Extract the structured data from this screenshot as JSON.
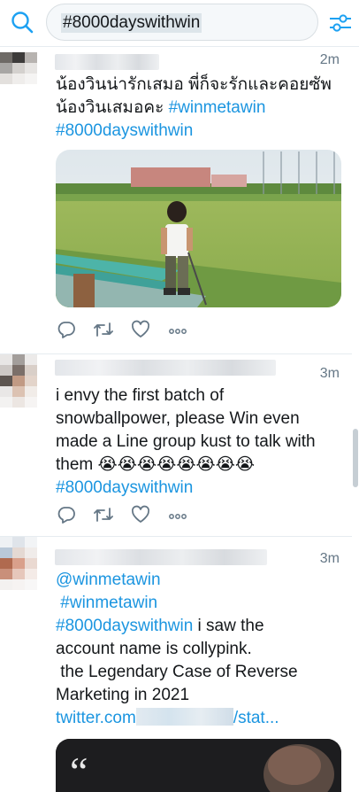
{
  "search": {
    "query": "#8000dayswithwin"
  },
  "icons": {
    "search": "search-icon",
    "filter": "sliders-icon",
    "reply": "reply-icon",
    "retweet": "retweet-icon",
    "like": "heart-icon",
    "more": "more-icon"
  },
  "colors": {
    "link": "#1b95e0",
    "icon": "#657786",
    "accent": "#1da1f2"
  },
  "tweets": [
    {
      "time": "2m",
      "line1": "น้องวินน่ารักเสมอ พี่ก็จะรักและคอยซัพ",
      "line2_text": "น้องวินเสมอคะ ",
      "line2_link": "#winmetawin",
      "line3_link": "#8000dayswithwin"
    },
    {
      "time": "3m",
      "line1": "i envy the first batch of",
      "line2": "snowballpower, please Win even",
      "line3": "made a Line group kust to talk with",
      "line4": "them 😭😭😭😭😭😭😭😭",
      "line5_link": "#8000dayswithwin"
    },
    {
      "time": "3m",
      "line1_link": "@winmetawin",
      "line2_link": "#winmetawin",
      "line3_link": "#8000dayswithwin",
      "line3_text": " i saw the",
      "line4": "account name is collypink.",
      "line5": "the Legendary Case of Reverse",
      "line6": "Marketing in 2021",
      "line7_link_a": "twitter.com",
      "line7_link_b": "/stat..."
    }
  ]
}
